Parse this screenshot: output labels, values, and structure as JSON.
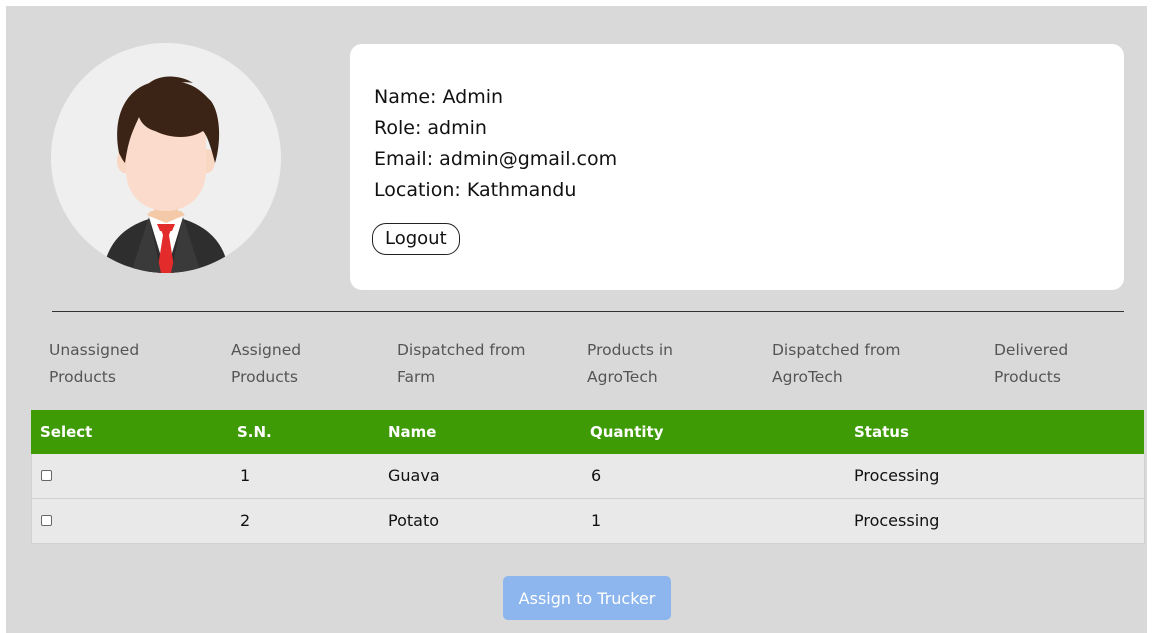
{
  "profile": {
    "name_label": "Name:",
    "name": "Admin",
    "role_label": "Role:",
    "role": "admin",
    "email_label": "Email:",
    "email": "admin@gmail.com",
    "location_label": "Location:",
    "location": "Kathmandu",
    "logout_label": "Logout"
  },
  "tabs": [
    {
      "label": "Unassigned\nProducts"
    },
    {
      "label": "Assigned\nProducts"
    },
    {
      "label": "Dispatched from\nFarm"
    },
    {
      "label": "Products in\nAgroTech"
    },
    {
      "label": "Dispatched from\nAgroTech"
    },
    {
      "label": "Delivered\nProducts"
    }
  ],
  "table": {
    "headers": {
      "select": "Select",
      "sn": "S.N.",
      "name": "Name",
      "quantity": "Quantity",
      "status": "Status"
    },
    "rows": [
      {
        "sn": "1",
        "name": "Guava",
        "quantity": "6",
        "status": "Processing"
      },
      {
        "sn": "2",
        "name": "Potato",
        "quantity": "1",
        "status": "Processing"
      }
    ]
  },
  "actions": {
    "assign_label": "Assign to Trucker"
  },
  "colors": {
    "header_green": "#3e9b06",
    "assign_button": "#8db6ee",
    "page_bg": "#d9d9d9"
  }
}
